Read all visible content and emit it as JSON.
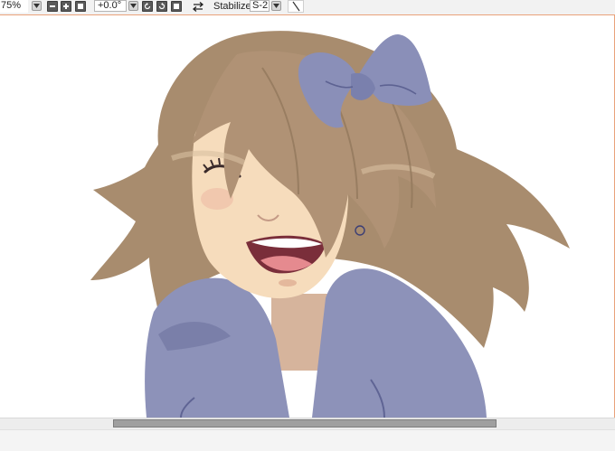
{
  "toolbar": {
    "zoom_value": "75%",
    "rotation_value": "+0.0°",
    "stabilizer_label": "Stabilizer",
    "stabilizer_value": "S-2"
  },
  "icons": {
    "zoom_dropdown": "chevron-down-icon",
    "zoom_out": "minus-icon",
    "zoom_in": "plus-icon",
    "fit": "square-icon",
    "rotation_dropdown": "chevron-down-icon",
    "rotate_left": "rotate-left-icon",
    "rotate_right": "rotate-right-icon",
    "rotate_reset": "square-icon",
    "flip": "flip-horizontal-icon",
    "stabilizer_dropdown": "chevron-down-icon",
    "pen": "pen-line-icon"
  },
  "colors": {
    "accent": "#e9a27a",
    "hair": "#a88c6e",
    "bow": "#8a8fb8",
    "skin": "#f6dcbc",
    "sweater": "#8d92b9"
  }
}
